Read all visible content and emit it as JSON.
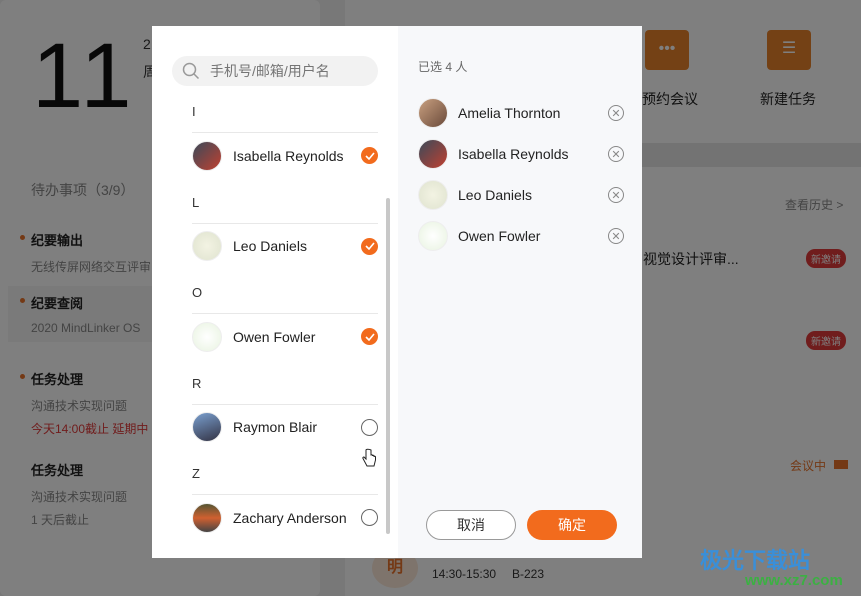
{
  "background": {
    "day": "11",
    "date_line1": "2",
    "date_line2": "周",
    "todo_title": "待办事项（3/9）",
    "todos": [
      {
        "title": "纪要输出",
        "sub": "无线传屏网络交互评审",
        "dot": true
      },
      {
        "title": "纪要查阅",
        "sub": "2020 MindLinker OS",
        "dot": true
      },
      {
        "title": "任务处理",
        "sub": "沟通技术实现问题",
        "deadline": "今天14:00截止  延期中",
        "dot": true
      },
      {
        "title": "任务处理",
        "sub": "沟通技术实现问题",
        "deadline": "1 天后截止",
        "dot": false
      }
    ],
    "quick": [
      {
        "label": "预约会议",
        "icon": "calendar-icon"
      },
      {
        "label": "新建任务",
        "icon": "task-list-icon"
      }
    ],
    "history": "查看历史 >",
    "meeting_title": "视觉设计评审...",
    "badge": "新邀请",
    "in_meeting": "会议中",
    "avatar_char": "明",
    "time": "14:30-15:30",
    "room": "B-223"
  },
  "modal": {
    "search_placeholder": "手机号/邮箱/用户名",
    "groups": [
      {
        "letter": "I",
        "name": "Isabella Reynolds",
        "checked": true
      },
      {
        "letter": "L",
        "name": "Leo Daniels",
        "checked": true
      },
      {
        "letter": "O",
        "name": "Owen Fowler",
        "checked": true
      },
      {
        "letter": "R",
        "name": "Raymon Blair",
        "checked": false
      },
      {
        "letter": "Z",
        "name": "Zachary Anderson",
        "checked": false
      }
    ],
    "selected_count": "已选 4 人",
    "selected": [
      "Amelia Thornton",
      "Isabella Reynolds",
      "Leo Daniels",
      "Owen Fowler"
    ],
    "cancel": "取消",
    "confirm": "确定"
  },
  "watermark": {
    "text": "极光下载站",
    "url": "www.xz7.com"
  },
  "colors": {
    "accent": "#f26b1d",
    "badge": "#e03a3a"
  }
}
